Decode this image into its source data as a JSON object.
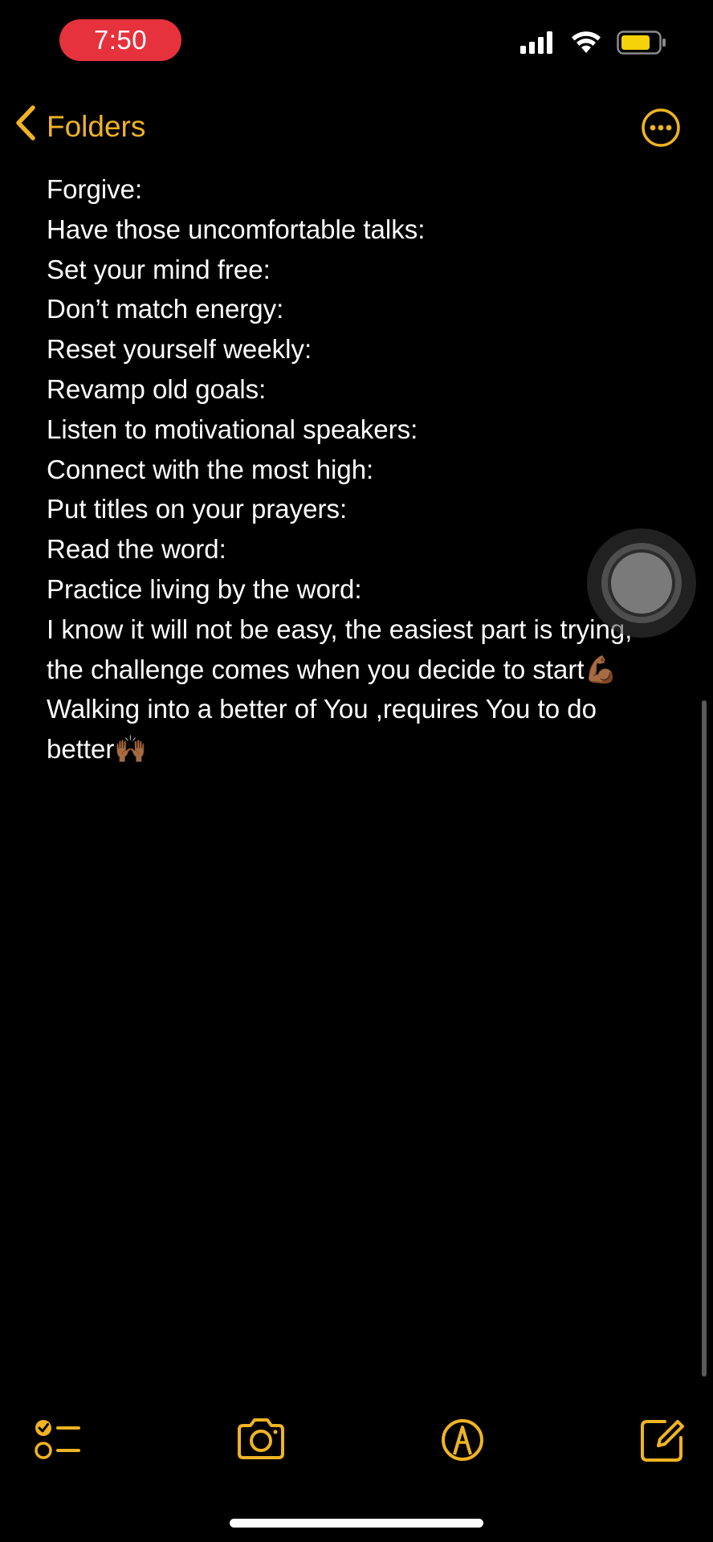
{
  "status_bar": {
    "time": "7:50"
  },
  "nav": {
    "back_label": "Folders"
  },
  "note": {
    "lines": [
      "Forgive:",
      "Have those uncomfortable talks:",
      "Set your mind free:",
      "Don’t match energy:",
      "Reset yourself weekly:",
      "Revamp old goals:",
      "Listen to motivational speakers:",
      "Connect with the most high:",
      "Put titles on your prayers:",
      "Read the word:",
      "Practice living by the word:"
    ],
    "paragraph_1": "I know it will not be easy, the easiest part is trying, the challenge comes when you decide to start💪🏾",
    "paragraph_2": "Walking into a better of You ,requires You to do better🙌🏾"
  },
  "icons": {
    "back": "chevron-left-icon",
    "more": "ellipsis-circle-icon",
    "checklist": "checklist-icon",
    "camera": "camera-icon",
    "markup": "pen-tip-circle-icon",
    "compose": "compose-icon"
  },
  "colors": {
    "accent": "#f0b323",
    "time_pill": "#e5323c",
    "battery": "#f5d20a",
    "background": "#000000"
  }
}
